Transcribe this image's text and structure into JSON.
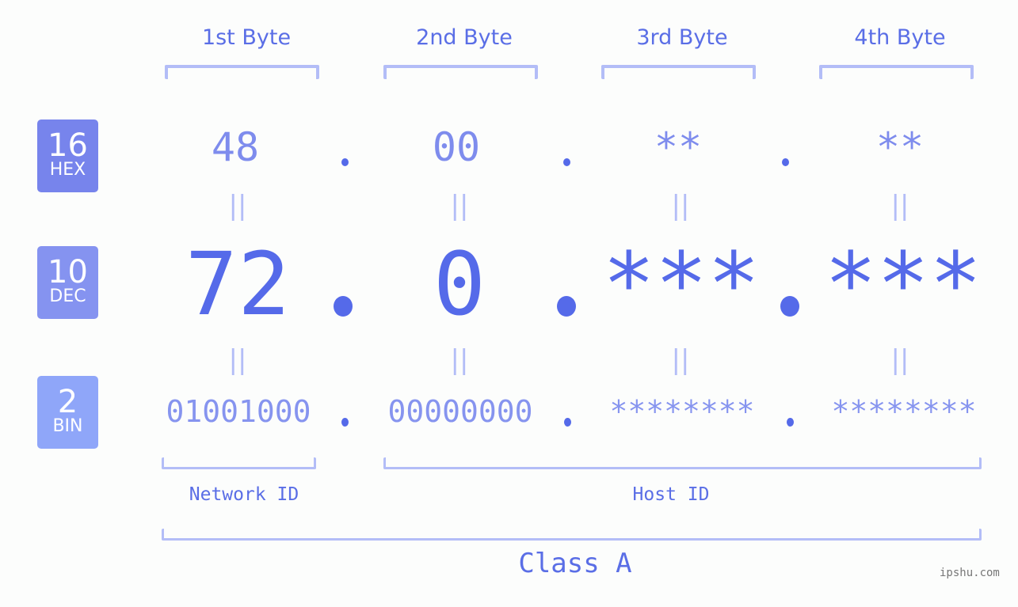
{
  "bytes": [
    {
      "header": "1st Byte",
      "hex": "48",
      "dec": "72",
      "bin": "01001000"
    },
    {
      "header": "2nd Byte",
      "hex": "00",
      "dec": "0",
      "bin": "00000000"
    },
    {
      "header": "3rd Byte",
      "hex": "**",
      "dec": "***",
      "bin": "********"
    },
    {
      "header": "4th Byte",
      "hex": "**",
      "dec": "***",
      "bin": "********"
    }
  ],
  "badges": {
    "hex": {
      "number": "16",
      "label": "HEX",
      "color": "#7784ec"
    },
    "dec": {
      "number": "10",
      "label": "DEC",
      "color": "#8593f0"
    },
    "bin": {
      "number": "2",
      "label": "BIN",
      "color": "#8fa6f9"
    }
  },
  "equals_symbol": "||",
  "network_id_label": "Network ID",
  "host_id_label": "Host ID",
  "class_label": "Class A",
  "watermark": "ipshu.com",
  "colors": {
    "accent": "#556ae9",
    "bracket": "#b3bdf7",
    "hex_text": "#7e8ced",
    "bin_text": "#8694ef"
  }
}
